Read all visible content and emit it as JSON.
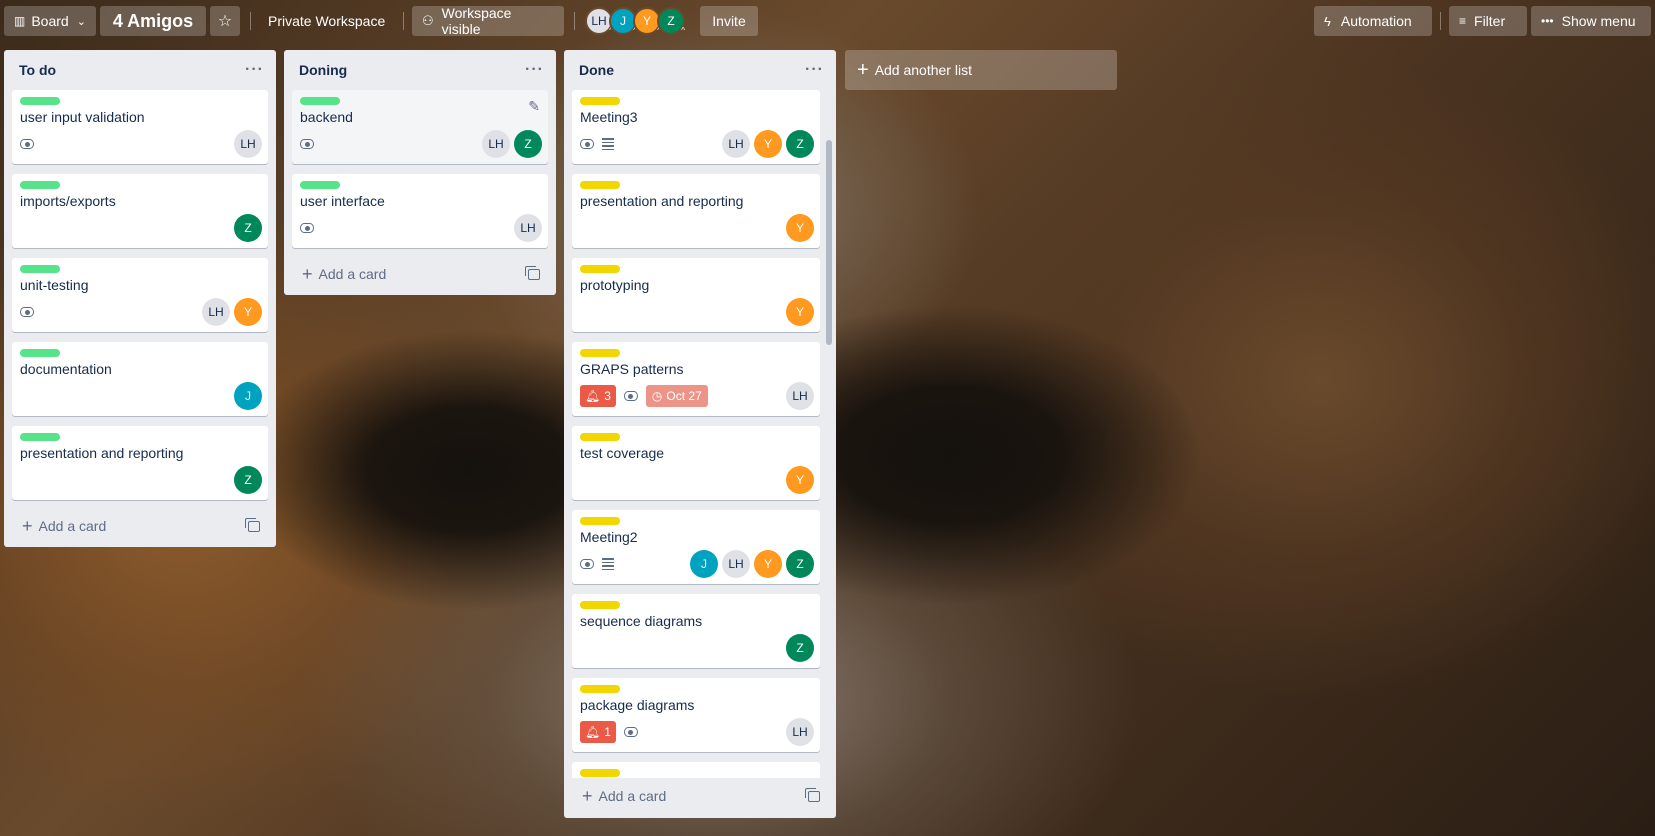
{
  "topbar": {
    "view_label": "Board",
    "board_title": "4 Amigos",
    "workspace": "Private Workspace",
    "visibility": "Workspace visible",
    "members": [
      "LH",
      "J",
      "Y",
      "Z"
    ],
    "invite": "Invite",
    "automation": "Automation",
    "filter": "Filter",
    "show_menu": "Show menu"
  },
  "lists": [
    {
      "title": "To do",
      "add_card": "Add a card",
      "cards": [
        {
          "title": "user input validation",
          "label": "green",
          "watch": true,
          "members": [
            "LH"
          ]
        },
        {
          "title": "imports/exports",
          "label": "green",
          "members": [
            "Z"
          ]
        },
        {
          "title": "unit-testing",
          "label": "green",
          "watch": true,
          "members": [
            "LH",
            "Y"
          ]
        },
        {
          "title": "documentation",
          "label": "green",
          "members": [
            "J"
          ]
        },
        {
          "title": "presentation and reporting",
          "label": "green",
          "members": [
            "Z"
          ]
        }
      ]
    },
    {
      "title": "Doning",
      "add_card": "Add a card",
      "cards": [
        {
          "title": "backend",
          "label": "green",
          "watch": true,
          "members": [
            "LH",
            "Z"
          ]
        },
        {
          "title": "user interface",
          "label": "green",
          "watch": true,
          "members": [
            "LH"
          ]
        }
      ]
    },
    {
      "title": "Done",
      "add_card": "Add a card",
      "cards": [
        {
          "title": "Meeting3",
          "label": "yellow",
          "watch": true,
          "description": true,
          "members": [
            "LH",
            "Y",
            "Z"
          ]
        },
        {
          "title": "presentation and reporting",
          "label": "yellow",
          "members": [
            "Y"
          ]
        },
        {
          "title": "prototyping",
          "label": "yellow",
          "members": [
            "Y"
          ]
        },
        {
          "title": "GRAPS patterns",
          "label": "yellow",
          "notifications": "3",
          "watch": true,
          "due": "Oct 27",
          "members": [
            "LH"
          ]
        },
        {
          "title": "test coverage",
          "label": "yellow",
          "members": [
            "Y"
          ]
        },
        {
          "title": "Meeting2",
          "label": "yellow",
          "watch": true,
          "description": true,
          "members": [
            "J",
            "LH",
            "Y",
            "Z"
          ]
        },
        {
          "title": "sequence diagrams",
          "label": "yellow",
          "members": [
            "Z"
          ]
        },
        {
          "title": "package diagrams",
          "label": "yellow",
          "notifications": "1",
          "watch": true,
          "members": [
            "LH"
          ]
        }
      ]
    }
  ],
  "add_another_list": "Add another list",
  "colors": {
    "green_label": "#57e389",
    "yellow_label": "#f2d600",
    "notification": "#eb5a46",
    "due_overdue": "#ec9488"
  }
}
